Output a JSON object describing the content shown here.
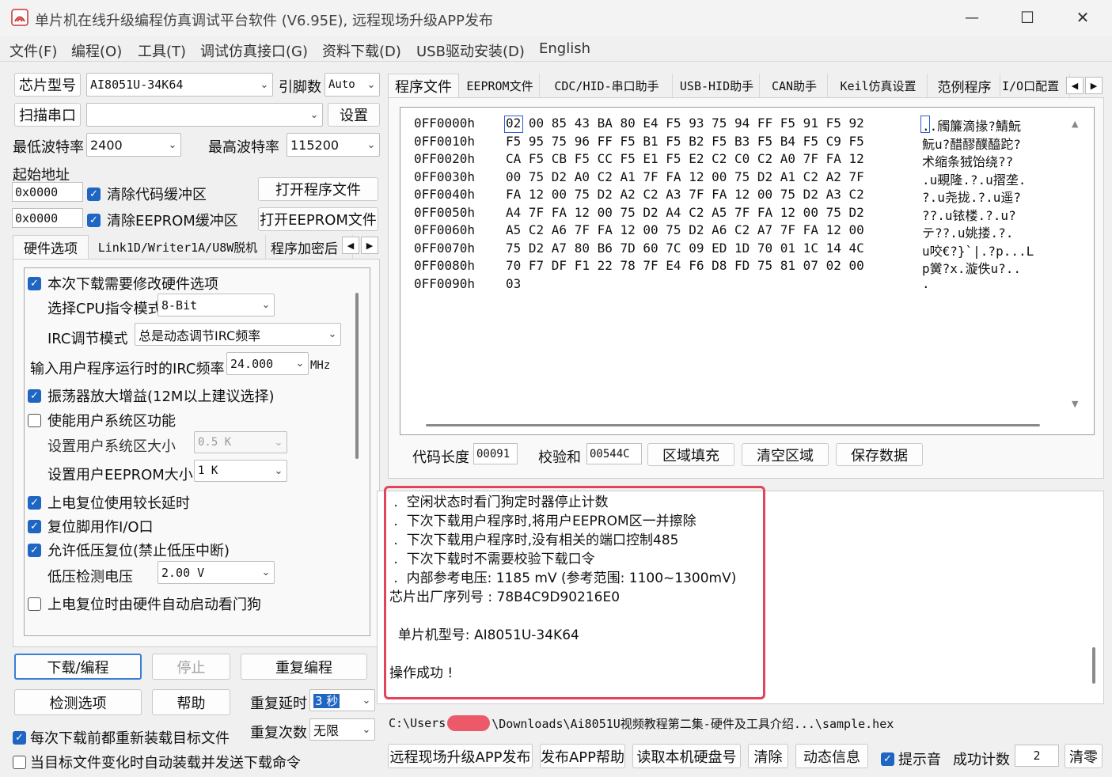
{
  "window": {
    "title": "单片机在线升级编程仿真调试平台软件 (V6.95E), 远程现场升级APP发布",
    "controls": {
      "minimize": "—",
      "maximize": "☐",
      "close": "✕"
    }
  },
  "menu": [
    "文件(F)",
    "编程(O)",
    "工具(T)",
    "调试仿真接口(G)",
    "资料下载(D)",
    "USB驱动安装(D)",
    "English"
  ],
  "left": {
    "chip_type_label": "芯片型号",
    "chip_type_value": "AI8051U-34K64",
    "pin_count_label": "引脚数",
    "pin_count_value": "Auto",
    "scan_port_button": "扫描串口",
    "port_value": "",
    "settings_button": "设置",
    "min_baud_label": "最低波特率",
    "min_baud_value": "2400",
    "max_baud_label": "最高波特率",
    "max_baud_value": "115200",
    "start_addr_label": "起始地址",
    "code_addr": "0x0000",
    "eeprom_addr": "0x0000",
    "clear_code_buffer": "清除代码缓冲区",
    "clear_eeprom_buffer": "清除EEPROM缓冲区",
    "open_program_button": "打开程序文件",
    "open_eeprom_button": "打开EEPROM文件",
    "tabs": [
      "硬件选项",
      "Link1D/Writer1A/U8W脱机",
      "程序加密后"
    ],
    "hw": {
      "modify_hw": "本次下载需要修改硬件选项",
      "cpu_mode_label": "选择CPU指令模式",
      "cpu_mode_value": "8-Bit",
      "irc_mode_label": "IRC调节模式",
      "irc_mode_value": "总是动态调节IRC频率",
      "irc_freq_label": "输入用户程序运行时的IRC频率",
      "irc_freq_value": "24.000",
      "irc_freq_unit": "MHz",
      "osc_gain": "振荡器放大增益(12M以上建议选择)",
      "enable_sys_area": "使能用户系统区功能",
      "sys_area_size_label": "设置用户系统区大小",
      "sys_area_size_value": "0.5  K",
      "eeprom_size_label": "设置用户EEPROM大小",
      "eeprom_size_value": "1    K",
      "long_reset_delay": "上电复位使用较长延时",
      "reset_pin_io": "复位脚用作I/O口",
      "lvd_reset": "允许低压复位(禁止低压中断)",
      "lvd_voltage_label": "低压检测电压",
      "lvd_voltage_value": "2.00 V",
      "wdt_auto": "上电复位时由硬件自动启动看门狗"
    },
    "download_button": "下载/编程",
    "stop_button": "停止",
    "reprogram_button": "重复编程",
    "check_options_button": "检测选项",
    "help_button": "帮助",
    "repeat_delay_label": "重复延时",
    "repeat_delay_value": "3 秒",
    "repeat_count_label": "重复次数",
    "repeat_count_value": "无限",
    "reload_before_download": "每次下载前都重新装载目标文件",
    "auto_reload_on_change": "当目标文件变化时自动装载并发送下载命令"
  },
  "right": {
    "tabs": [
      "程序文件",
      "EEPROM文件",
      "CDC/HID-串口助手",
      "USB-HID助手",
      "CAN助手",
      "Keil仿真设置",
      "范例程序",
      "I/O口配置"
    ],
    "hex": {
      "rows": [
        {
          "addr": "0FF0000h",
          "bytes": "02 00 85 43 BA 80 E4 F5 93 75 94 FF F5 91 F5 92",
          "ascii": "..斶簾滴掾?鯖魭"
        },
        {
          "addr": "0FF0010h",
          "bytes": "F5 95 75 96 FF F5 B1 F5 B2 F5 B3 F5 B4 F5 C9 F5",
          "ascii": "魭u?醋醪醭醯跎?"
        },
        {
          "addr": "0FF0020h",
          "bytes": "CA F5 CB F5 CC F5 E1 F5 E2 C2 C0 C2 A0 7F FA 12",
          "ascii": "术缩条狨饴绕??"
        },
        {
          "addr": "0FF0030h",
          "bytes": "00 75 D2 A0 C2 A1 7F FA 12 00 75 D2 A1 C2 A2 7F",
          "ascii": ".u覡隆.?.u摺垄."
        },
        {
          "addr": "0FF0040h",
          "bytes": "FA 12 00 75 D2 A2 C2 A3 7F FA 12 00 75 D2 A3 C2",
          "ascii": "?.u尧拢.?.u遥?"
        },
        {
          "addr": "0FF0050h",
          "bytes": "A4 7F FA 12 00 75 D2 A4 C2 A5 7F FA 12 00 75 D2",
          "ascii": "??.u铱楼.?.u?"
        },
        {
          "addr": "0FF0060h",
          "bytes": "A5 C2 A6 7F FA 12 00 75 D2 A6 C2 A7 7F FA 12 00",
          "ascii": "テ??.u姚搂.?."
        },
        {
          "addr": "0FF0070h",
          "bytes": "75 D2 A7 80 B6 7D 60 7C 09 ED 1D 70 01 1C 14 4C",
          "ascii": "u咬€?}`|.?p...L"
        },
        {
          "addr": "0FF0080h",
          "bytes": "70 F7 DF F1 22 78 7F E4 F6 D8 FD 75 81 07 02 00",
          "ascii": "p黉?x.漩佚u?.."
        },
        {
          "addr": "0FF0090h",
          "bytes": "03",
          "ascii": "."
        }
      ]
    },
    "code_length_label": "代码长度",
    "code_length_value": "00091",
    "checksum_label": "校验和",
    "checksum_value": "00544C",
    "fill_button": "区域填充",
    "clear_area_button": "清空区域",
    "save_button": "保存数据",
    "log": [
      " .  空闲状态时看门狗定时器停止计数",
      " .  下次下载用户程序时,将用户EEPROM区一并擦除",
      " .  下次下载用户程序时,没有相关的端口控制485",
      " .  下次下载时不需要校验下载口令",
      " .  内部参考电压: 1185 mV (参考范围: 1100~1300mV)",
      "芯片出厂序列号 : 78B4C9D90216E0",
      "",
      "  单片机型号: AI8051U-34K64",
      "",
      "操作成功 !"
    ],
    "path_prefix": "C:\\Users",
    "path_suffix": "\\Downloads\\Ai8051U视频教程第二集-硬件及工具介绍...\\sample.hex",
    "bottom": {
      "publish_app_button": "远程现场升级APP发布",
      "app_help_button": "发布APP帮助",
      "read_disk_button": "读取本机硬盘号",
      "clear_button": "清除",
      "dynamic_info_button": "动态信息",
      "beep_label": "提示音",
      "success_count_label": "成功计数",
      "success_count_value": "2",
      "reset_count_button": "清零"
    }
  },
  "colors": {
    "highlight_border": "#e0455a",
    "checkbox_blue": "#1f66c2",
    "selection_blue": "#1f66c2"
  }
}
